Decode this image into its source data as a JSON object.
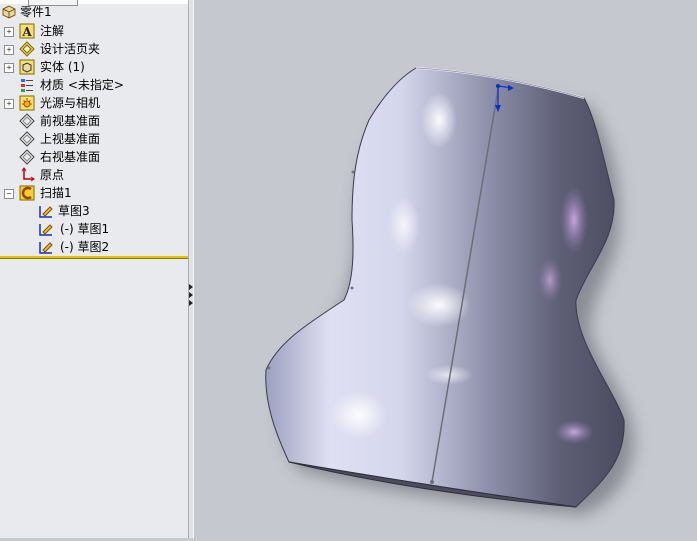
{
  "tree": {
    "root_label": "零件1",
    "items": [
      {
        "label": "注解",
        "icon": "annotations-icon"
      },
      {
        "label": "设计活页夹",
        "icon": "design-binder-icon"
      },
      {
        "label": "实体 (1)",
        "icon": "solid-bodies-icon"
      },
      {
        "label": "材质 <未指定>",
        "icon": "material-icon"
      },
      {
        "label": "光源与相机",
        "icon": "lights-cameras-icon"
      },
      {
        "label": "前视基准面",
        "icon": "plane-icon"
      },
      {
        "label": "上视基准面",
        "icon": "plane-icon"
      },
      {
        "label": "右视基准面",
        "icon": "plane-icon"
      },
      {
        "label": "原点",
        "icon": "origin-icon"
      },
      {
        "label": "扫描1",
        "icon": "sweep-icon"
      }
    ],
    "children": [
      {
        "label": "草图3",
        "icon": "sketch-icon"
      },
      {
        "label": "(-) 草图1",
        "icon": "sketch-icon"
      },
      {
        "label": "(-) 草图2",
        "icon": "sketch-icon"
      }
    ]
  },
  "colors": {
    "panel_bg": "#e9eaee",
    "viewport_bg": "#c5c8ce",
    "rollback_bar": "#e2c400",
    "sketch_arrow": "#0033cc",
    "body_light": "#f2f3fb",
    "body_dark": "#55566a"
  }
}
